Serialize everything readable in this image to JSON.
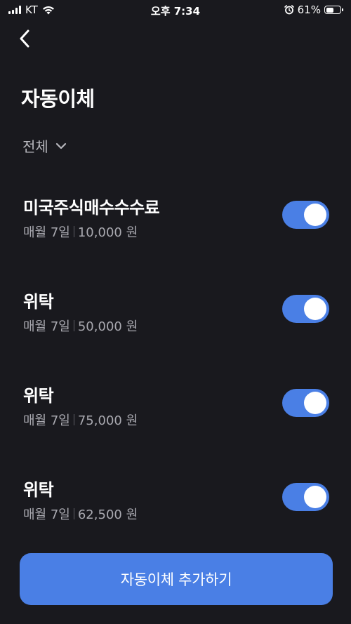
{
  "status_bar": {
    "carrier": "KT",
    "time": "오후 7:34",
    "battery": "61%",
    "battery_level": 0.61
  },
  "header": {
    "title": "자동이체"
  },
  "filter": {
    "selected": "전체"
  },
  "transfers": [
    {
      "title": "미국주식매수수수료",
      "schedule": "매월 7일",
      "amount": "10,000 원",
      "enabled": true
    },
    {
      "title": "위탁",
      "schedule": "매월 7일",
      "amount": "50,000 원",
      "enabled": true
    },
    {
      "title": "위탁",
      "schedule": "매월 7일",
      "amount": "75,000 원",
      "enabled": true
    },
    {
      "title": "위탁",
      "schedule": "매월 7일",
      "amount": "62,500 원",
      "enabled": true
    }
  ],
  "add_button": {
    "label": "자동이체 추가하기"
  },
  "colors": {
    "background": "#19191e",
    "accent": "#4a7fe5"
  }
}
